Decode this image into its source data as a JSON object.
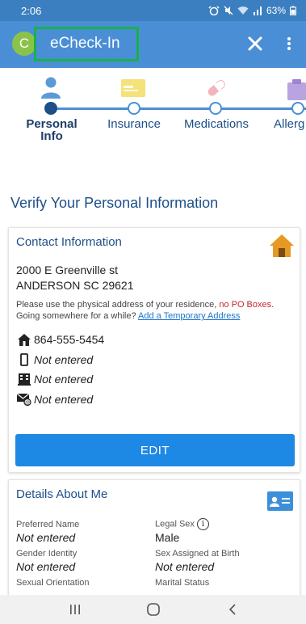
{
  "status_bar": {
    "time": "2:06",
    "battery": "63%"
  },
  "app_bar": {
    "avatar_letter": "C",
    "title": "eCheck-In",
    "close_icon": "close-icon",
    "more_icon": "more-vert-icon"
  },
  "stepper": {
    "steps": [
      {
        "label_line1": "Personal",
        "label_line2": "Info",
        "icon": "person-icon",
        "active": true
      },
      {
        "label_line1": "Insurance",
        "label_line2": "",
        "icon": "insurance-card-icon",
        "active": false
      },
      {
        "label_line1": "Medications",
        "label_line2": "",
        "icon": "pill-icon",
        "active": false
      },
      {
        "label_line1": "Allerg",
        "label_line2": "",
        "icon": "allergies-icon",
        "active": false
      }
    ]
  },
  "page": {
    "section_title": "Verify Your Personal Information"
  },
  "contact": {
    "title": "Contact Information",
    "address_line1": "2000 E Greenville st",
    "address_line2": "ANDERSON SC 29621",
    "note_part1": "Please use the physical address of your residence, ",
    "note_warning": "no PO Boxes",
    "note_part2": ". Going somewhere for a while? ",
    "temp_address_link": "Add a Temporary Address",
    "home_phone": "864-555-5454",
    "mobile_phone": "Not entered",
    "work_phone": "Not entered",
    "email": "Not entered",
    "edit_label": "EDIT",
    "colors": {
      "accent": "#1e88e5",
      "warning": "#c62828",
      "home_icon": "#e69a24"
    }
  },
  "details": {
    "title": "Details About Me",
    "preferred_name_label": "Preferred Name",
    "preferred_name_value": "Not entered",
    "legal_sex_label": "Legal Sex",
    "legal_sex_value": "Male",
    "gender_identity_label": "Gender Identity",
    "gender_identity_value": "Not entered",
    "sex_at_birth_label": "Sex Assigned at Birth",
    "sex_at_birth_value": "Not entered",
    "sexual_orientation_label": "Sexual Orientation",
    "marital_status_label": "Marital Status",
    "info_glyph": "i"
  },
  "nav": {
    "recents_icon": "recents-icon",
    "home_icon": "home-circle-icon",
    "back_icon": "back-icon"
  }
}
